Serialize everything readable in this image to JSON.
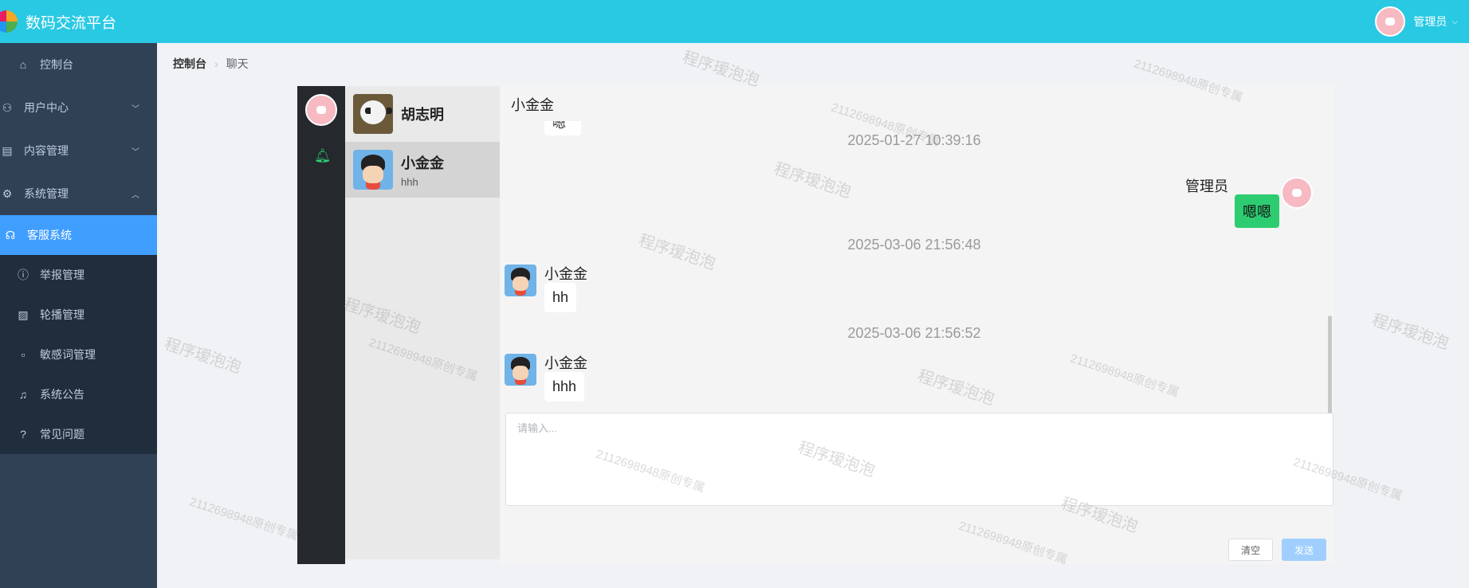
{
  "header": {
    "app_title": "数码交流平台",
    "user_name": "管理员",
    "caret": "⌵"
  },
  "sidebar": {
    "items": [
      {
        "label": "控制台",
        "icon": "dashboard-icon"
      },
      {
        "label": "用户中心",
        "icon": "user-icon",
        "expanded": false
      },
      {
        "label": "内容管理",
        "icon": "document-icon",
        "expanded": false
      },
      {
        "label": "系统管理",
        "icon": "gear-icon",
        "expanded": true
      },
      {
        "label": "客服系统",
        "icon": "headset-icon",
        "active": true
      },
      {
        "label": "举报管理",
        "icon": "warning-icon"
      },
      {
        "label": "轮播管理",
        "icon": "image-icon"
      },
      {
        "label": "敏感词管理",
        "icon": "file-icon"
      },
      {
        "label": "系统公告",
        "icon": "bell-icon"
      },
      {
        "label": "常见问题",
        "icon": "question-icon"
      }
    ],
    "accent_color": "#409eff",
    "bg_color": "#304156"
  },
  "breadcrumb": {
    "home": "控制台",
    "current": "聊天"
  },
  "contacts": [
    {
      "name": "胡志明",
      "last_message": "",
      "selected": false
    },
    {
      "name": "小金金",
      "last_message": "hhh",
      "selected": true
    }
  ],
  "chat": {
    "title": "小金金",
    "cut_bubble_text": "嗯好",
    "messages": [
      {
        "timestamp": "2025-01-27 10:39:16",
        "sender": "管理员",
        "text": "嗯嗯",
        "direction": "out"
      },
      {
        "timestamp": "2025-03-06 21:56:48",
        "sender": "小金金",
        "text": "hh",
        "direction": "in"
      },
      {
        "timestamp": "2025-03-06 21:56:52",
        "sender": "小金金",
        "text": "hhh",
        "direction": "in"
      }
    ],
    "input_placeholder": "请输入...",
    "clear_label": "清空",
    "send_label": "发送",
    "out_bubble_color": "#2ecc71"
  },
  "watermark": {
    "text_a": "程序瑷泡泡",
    "text_b": "2112698948原创专属"
  }
}
